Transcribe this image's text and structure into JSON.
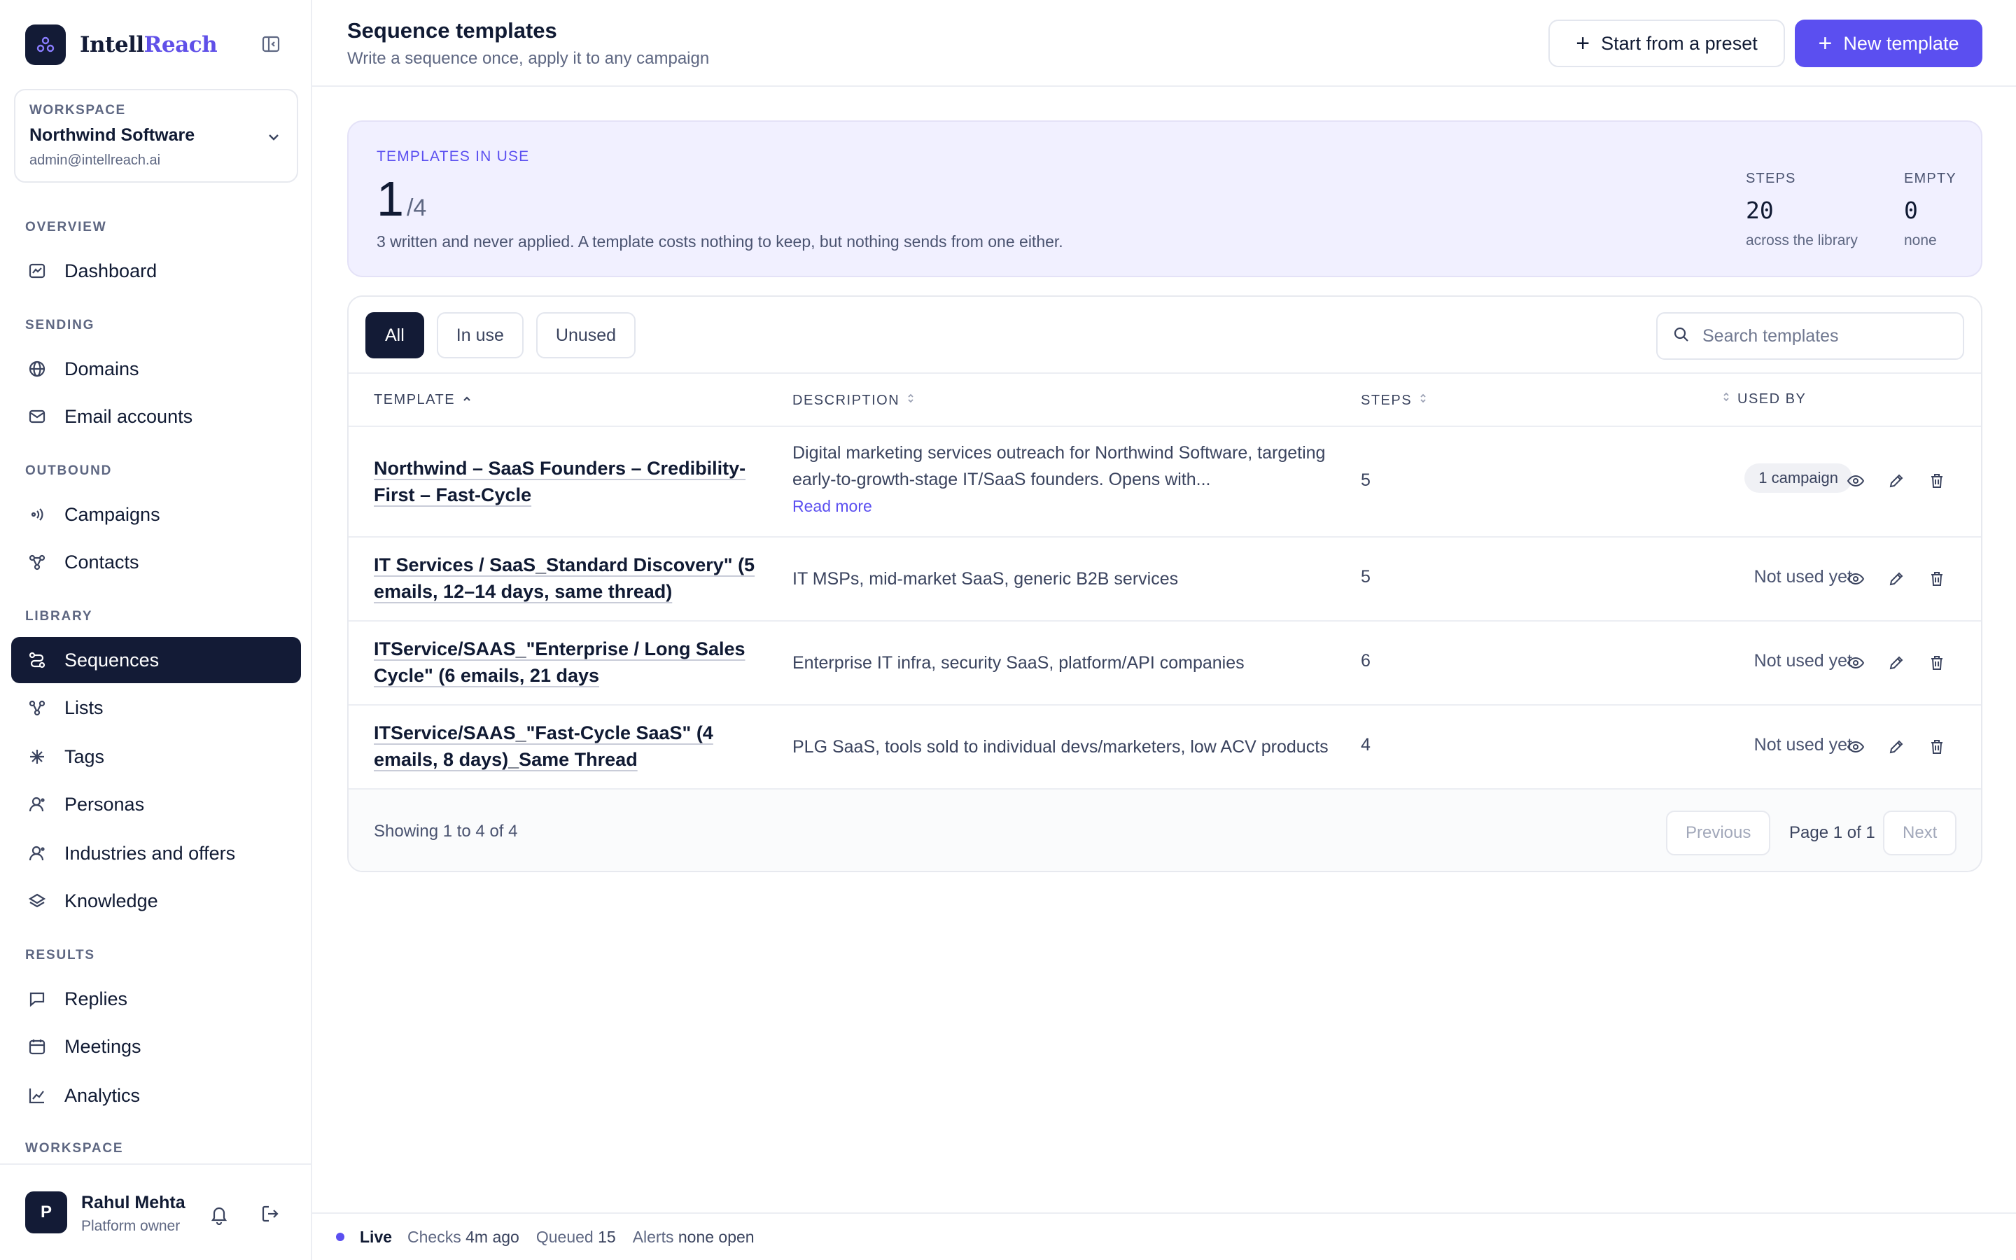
{
  "brand": {
    "name_a": "Intell",
    "name_b": "Reach"
  },
  "workspace": {
    "label": "WORKSPACE",
    "name": "Northwind Software",
    "email": "admin@intellreach.ai"
  },
  "nav": {
    "overview": "OVERVIEW",
    "sending": "SENDING",
    "outbound": "OUTBOUND",
    "library": "LIBRARY",
    "results": "RESULTS",
    "workspace": "WORKSPACE",
    "items": {
      "dashboard": "Dashboard",
      "domains": "Domains",
      "email_accounts": "Email accounts",
      "campaigns": "Campaigns",
      "contacts": "Contacts",
      "sequences": "Sequences",
      "lists": "Lists",
      "tags": "Tags",
      "personas": "Personas",
      "industries": "Industries and offers",
      "knowledge": "Knowledge",
      "replies": "Replies",
      "meetings": "Meetings",
      "analytics": "Analytics"
    }
  },
  "user": {
    "initial": "P",
    "name": "Rahul Mehta",
    "role": "Platform owner"
  },
  "header": {
    "title": "Sequence templates",
    "subtitle": "Write a sequence once, apply it to any campaign",
    "preset_label": "Start from a preset",
    "new_label": "New template"
  },
  "stats": {
    "label": "TEMPLATES IN USE",
    "in_use": "1",
    "total": "/4",
    "note": "3 written and never applied. A template costs nothing to keep, but nothing sends from one either.",
    "steps_label": "STEPS",
    "steps_value": "20",
    "steps_sub": "across the library",
    "empty_label": "EMPTY",
    "empty_value": "0",
    "empty_sub": "none"
  },
  "filters": {
    "all": "All",
    "in_use": "In use",
    "unused": "Unused"
  },
  "search": {
    "placeholder": "Search templates"
  },
  "columns": {
    "template": "TEMPLATE",
    "description": "DESCRIPTION",
    "steps": "STEPS",
    "used_by": "USED BY"
  },
  "rows": [
    {
      "name": "Northwind – SaaS Founders – Credibility-First – Fast-Cycle",
      "desc": "Digital marketing services outreach for Northwind Software, targeting early-to-growth-stage IT/SaaS founders. Opens with...",
      "read_more": "Read more",
      "steps": "5",
      "used": "1 campaign"
    },
    {
      "name": "IT Services / SaaS_Standard Discovery\" (5 emails, 12–14 days, same thread)",
      "desc": "IT MSPs, mid-market SaaS, generic B2B services",
      "steps": "5",
      "used": "Not used yet"
    },
    {
      "name": "ITService/SAAS_\"Enterprise / Long Sales Cycle\" (6 emails, 21 days",
      "desc": "Enterprise IT infra, security SaaS, platform/API companies",
      "steps": "6",
      "used": "Not used yet"
    },
    {
      "name": "ITService/SAAS_\"Fast-Cycle SaaS\" (4 emails, 8 days)_Same Thread",
      "desc": "PLG SaaS, tools sold to individual devs/marketers, low ACV products",
      "steps": "4",
      "used": "Not used yet"
    }
  ],
  "pagination": {
    "showing": "Showing 1 to 4 of 4",
    "previous": "Previous",
    "page": "Page 1 of 1",
    "next": "Next"
  },
  "status": {
    "live": "Live",
    "checks_label": "Checks",
    "checks_value": "4m ago",
    "queued_label": "Queued",
    "queued_value": "15",
    "alerts_label": "Alerts",
    "alerts_value": "none open"
  },
  "colors": {
    "accent": "#5b4ff0",
    "navy": "#131b36",
    "stats_bg": "#f1f0ff"
  }
}
